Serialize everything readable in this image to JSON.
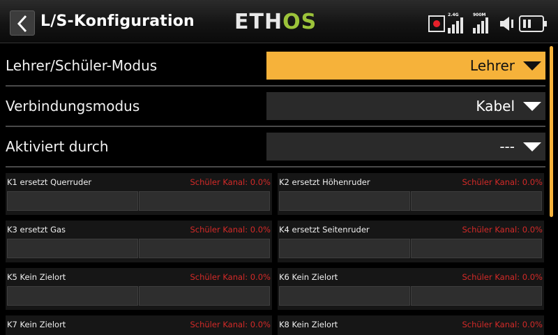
{
  "header": {
    "title": "L/S-Konfiguration",
    "logo_left": "ETH",
    "logo_right": "OS",
    "rf_label_1": "2.4G",
    "rf_label_2": "900M"
  },
  "settings": [
    {
      "label": "Lehrer/Schüler-Modus",
      "value": "Lehrer",
      "active": true
    },
    {
      "label": "Verbindungsmodus",
      "value": "Kabel",
      "active": false
    },
    {
      "label": "Aktiviert durch",
      "value": "---",
      "active": false
    }
  ],
  "channels": [
    {
      "name": "K1 ersetzt Querruder",
      "student": "Schüler Kanal: 0.0%"
    },
    {
      "name": "K2 ersetzt Höhenruder",
      "student": "Schüler Kanal: 0.0%"
    },
    {
      "name": "K3 ersetzt Gas",
      "student": "Schüler Kanal: 0.0%"
    },
    {
      "name": "K4 ersetzt Seitenruder",
      "student": "Schüler Kanal: 0.0%"
    },
    {
      "name": "K5 Kein Zielort",
      "student": "Schüler Kanal: 0.0%"
    },
    {
      "name": "K6 Kein Zielort",
      "student": "Schüler Kanal: 0.0%"
    },
    {
      "name": "K7 Kein Zielort",
      "student": "Schüler Kanal: 0.0%"
    },
    {
      "name": "K8 Kein Zielort",
      "student": "Schüler Kanal: 0.0%"
    }
  ],
  "colors": {
    "accent": "#f6b23a",
    "logo_green": "#9cc33a",
    "warning_red": "#d42a28",
    "record_red": "#e8202a"
  },
  "icons": [
    "back-arrow-icon",
    "record-icon",
    "signal-2-4g-icon",
    "signal-900m-icon",
    "speaker-icon",
    "battery-icon",
    "dropdown-arrow-icon"
  ]
}
